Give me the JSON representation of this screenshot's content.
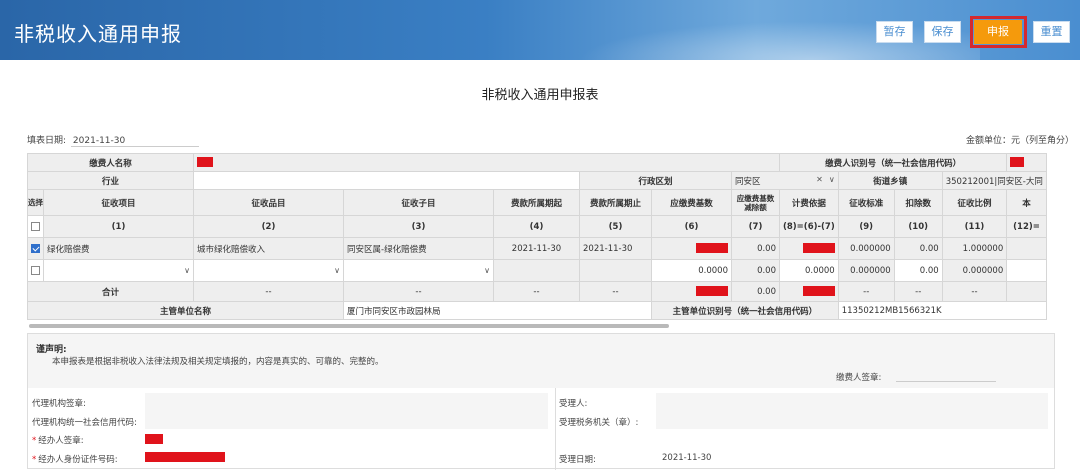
{
  "header": {
    "title": "非税收入通用申报",
    "buttons": {
      "save_draft": "暂存",
      "save": "保存",
      "submit": "申报",
      "reset": "重置"
    }
  },
  "form_title": "非税收入通用申报表",
  "fill_date_label": "填表日期:",
  "fill_date": "2021-11-30",
  "unit_note": "金额单位：元（列至角分）",
  "table": {
    "payer_name_label": "缴费人名称",
    "payer_id_label": "缴费人识别号（统一社会信用代码）",
    "industry_label": "行业",
    "district_label": "行政区划",
    "district_value": "同安区",
    "street_label": "街道乡镇",
    "street_value": "350212001|同安区-大同",
    "headers": [
      "选择",
      "征收项目",
      "征收品目",
      "征收子目",
      "费款所属期起",
      "费款所属期止",
      "应缴费基数",
      "应缴费基数减除额",
      "计费依据",
      "征收标准",
      "扣除数",
      "征收比例",
      "本"
    ],
    "col_numbers": [
      "(1)",
      "(2)",
      "(3)",
      "(4)",
      "(5)",
      "(6)",
      "(7)",
      "(8)=(6)-(7)",
      "(9)",
      "(10)",
      "(11)",
      "(12)="
    ],
    "row1": {
      "project": "绿化赔偿费",
      "item": "城市绿化赔偿收入",
      "subitem": "同安区属-绿化赔偿费",
      "start": "2021-11-30",
      "end": "2021-11-30",
      "deduct_amount": "0.00",
      "standard": "0.000000",
      "deduction": "0.00",
      "ratio": "1.000000"
    },
    "row2": {
      "base": "0.0000",
      "deduct_amount": "0.00",
      "basis": "0.0000",
      "standard": "0.000000",
      "deduction": "0.00",
      "ratio": "0.000000"
    },
    "total_label": "合计",
    "dash": "--",
    "total_deduct_amount": "0.00",
    "authority_name_label": "主管单位名称",
    "authority_name": "厦门市同安区市政园林局",
    "authority_id_label": "主管单位识别号（统一社会信用代码）",
    "authority_id": "11350212MB1566321K"
  },
  "declaration": {
    "title": "谨声明:",
    "text": "本申报表是根据非税收入法律法规及相关规定填报的，内容是真实的、可靠的、完整的。",
    "payer_sign": "缴费人签章:",
    "agent_seal": "代理机构签章:",
    "agent_code": "代理机构统一社会信用代码:",
    "handler_sign": "经办人签章:",
    "handler_id": "经办人身份证件号码:",
    "receiver": "受理人:",
    "tax_office": "受理税务机关（章）:",
    "receive_date_label": "受理日期:",
    "receive_date": "2021-11-30"
  },
  "colors": {
    "header_blue": "#3a7fc4",
    "accent_orange": "#f59a0c",
    "redact": "#e0131b",
    "highlight_box": "#d4292f"
  },
  "icons": [
    "checkbox-icon",
    "chevron-down-icon",
    "close-icon"
  ]
}
